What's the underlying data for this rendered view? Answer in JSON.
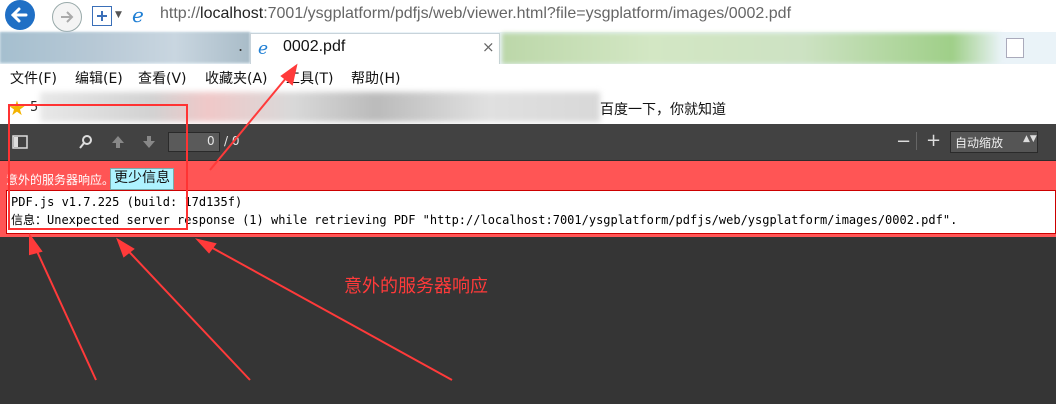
{
  "browser": {
    "url_prefix": "http://",
    "url_host": "localhost",
    "url_rest": ":7001/ysgplatform/pdfjs/web/viewer.html?file=ysgplatform/images/0002.pdf",
    "tab_overflow": ".",
    "active_tab_title": "0002.pdf",
    "tab_close": "×"
  },
  "menu": [
    "文件(F)",
    "编辑(E)",
    "查看(V)",
    "收藏夹(A)",
    "工具(T)",
    "帮助(H)"
  ],
  "favorites": {
    "first_char": "5",
    "baidu": "百度一下，你就知道"
  },
  "pdf_toolbar": {
    "page_number": "0",
    "page_count": "/ 0",
    "zoom_minus": "−",
    "zoom_plus": "+",
    "zoom_label": "自动缩放"
  },
  "error": {
    "message": "意外的服务器响应。",
    "less_info": "更少信息",
    "line1": "PDF.js v1.7.225 (build: 17d135f)",
    "line2": "信息：Unexpected server response (1) while retrieving PDF \"http://localhost:7001/ysgplatform/pdfjs/web/ysgplatform/images/0002.pdf\"."
  },
  "annotation": {
    "text": "意外的服务器响应",
    "color": "#ff3a3a"
  },
  "colors": {
    "error_bar": "#ff5555",
    "pdf_toolbar": "#424242",
    "viewer_bg": "#353535",
    "less_info_bg": "#aef3ff"
  }
}
